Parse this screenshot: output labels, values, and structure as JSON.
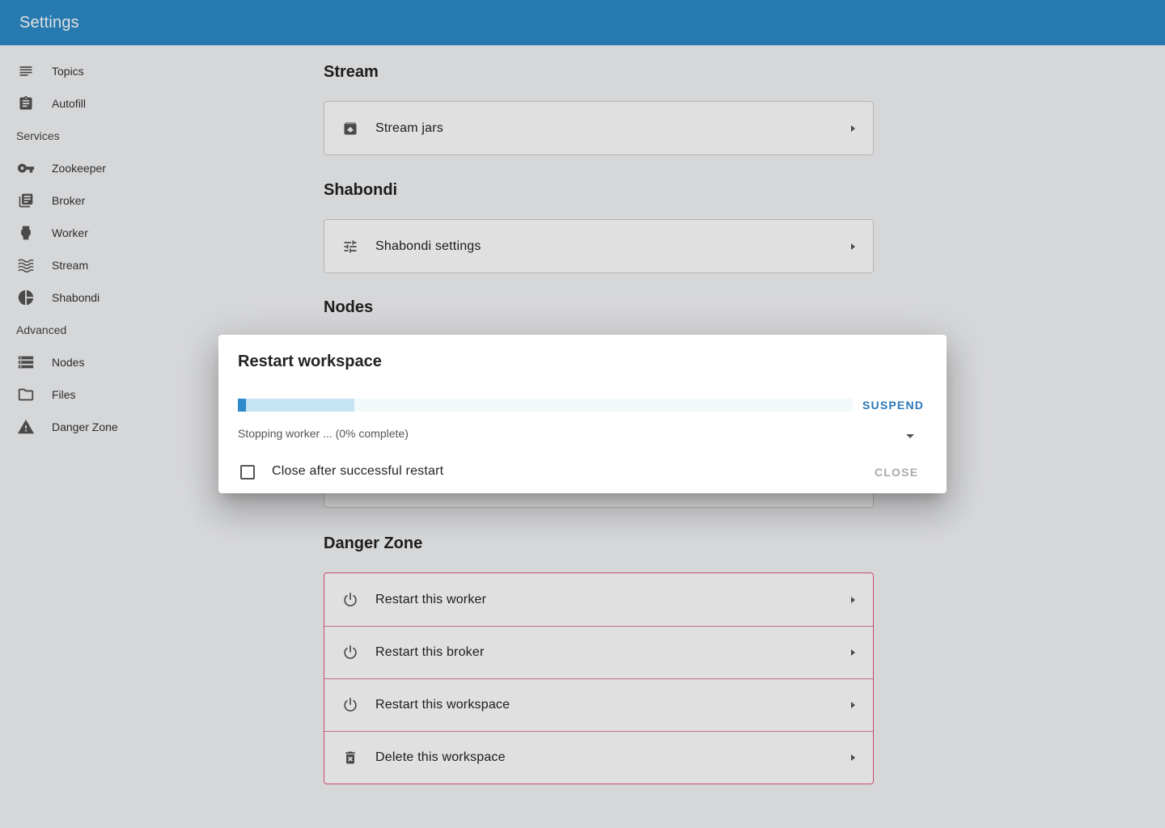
{
  "appbar": {
    "title": "Settings"
  },
  "sidebar": {
    "items": [
      {
        "label": "Topics",
        "icon": "subject-icon"
      },
      {
        "label": "Autofill",
        "icon": "assignment-icon"
      }
    ],
    "services_header": "Services",
    "services": [
      {
        "label": "Zookeeper",
        "icon": "key-icon"
      },
      {
        "label": "Broker",
        "icon": "library-books-icon"
      },
      {
        "label": "Worker",
        "icon": "power-input-icon"
      },
      {
        "label": "Stream",
        "icon": "waves-icon"
      },
      {
        "label": "Shabondi",
        "icon": "pie-chart-icon"
      }
    ],
    "advanced_header": "Advanced",
    "advanced": [
      {
        "label": "Nodes",
        "icon": "storage-icon"
      },
      {
        "label": "Files",
        "icon": "folder-icon"
      },
      {
        "label": "Danger Zone",
        "icon": "warning-icon"
      }
    ]
  },
  "main": {
    "stream": {
      "title": "Stream",
      "row": "Stream jars"
    },
    "shabondi": {
      "title": "Shabondi",
      "row": "Shabondi settings"
    },
    "nodes": {
      "title": "Nodes"
    },
    "danger": {
      "title": "Danger Zone",
      "rows": [
        "Restart this worker",
        "Restart this broker",
        "Restart this workspace",
        "Delete this workspace"
      ]
    }
  },
  "dialog": {
    "title": "Restart workspace",
    "progress_value": 0.013,
    "progress_buffer": 0.189,
    "suspend_label": "SUSPEND",
    "status": "Stopping worker ... (0% complete)",
    "checkbox_label": "Close after successful restart",
    "checkbox_checked": false,
    "close_label": "CLOSE"
  },
  "colors": {
    "primary": "#2d8bc9",
    "danger": "#e5567b",
    "buffer": "#c6e2f5"
  }
}
